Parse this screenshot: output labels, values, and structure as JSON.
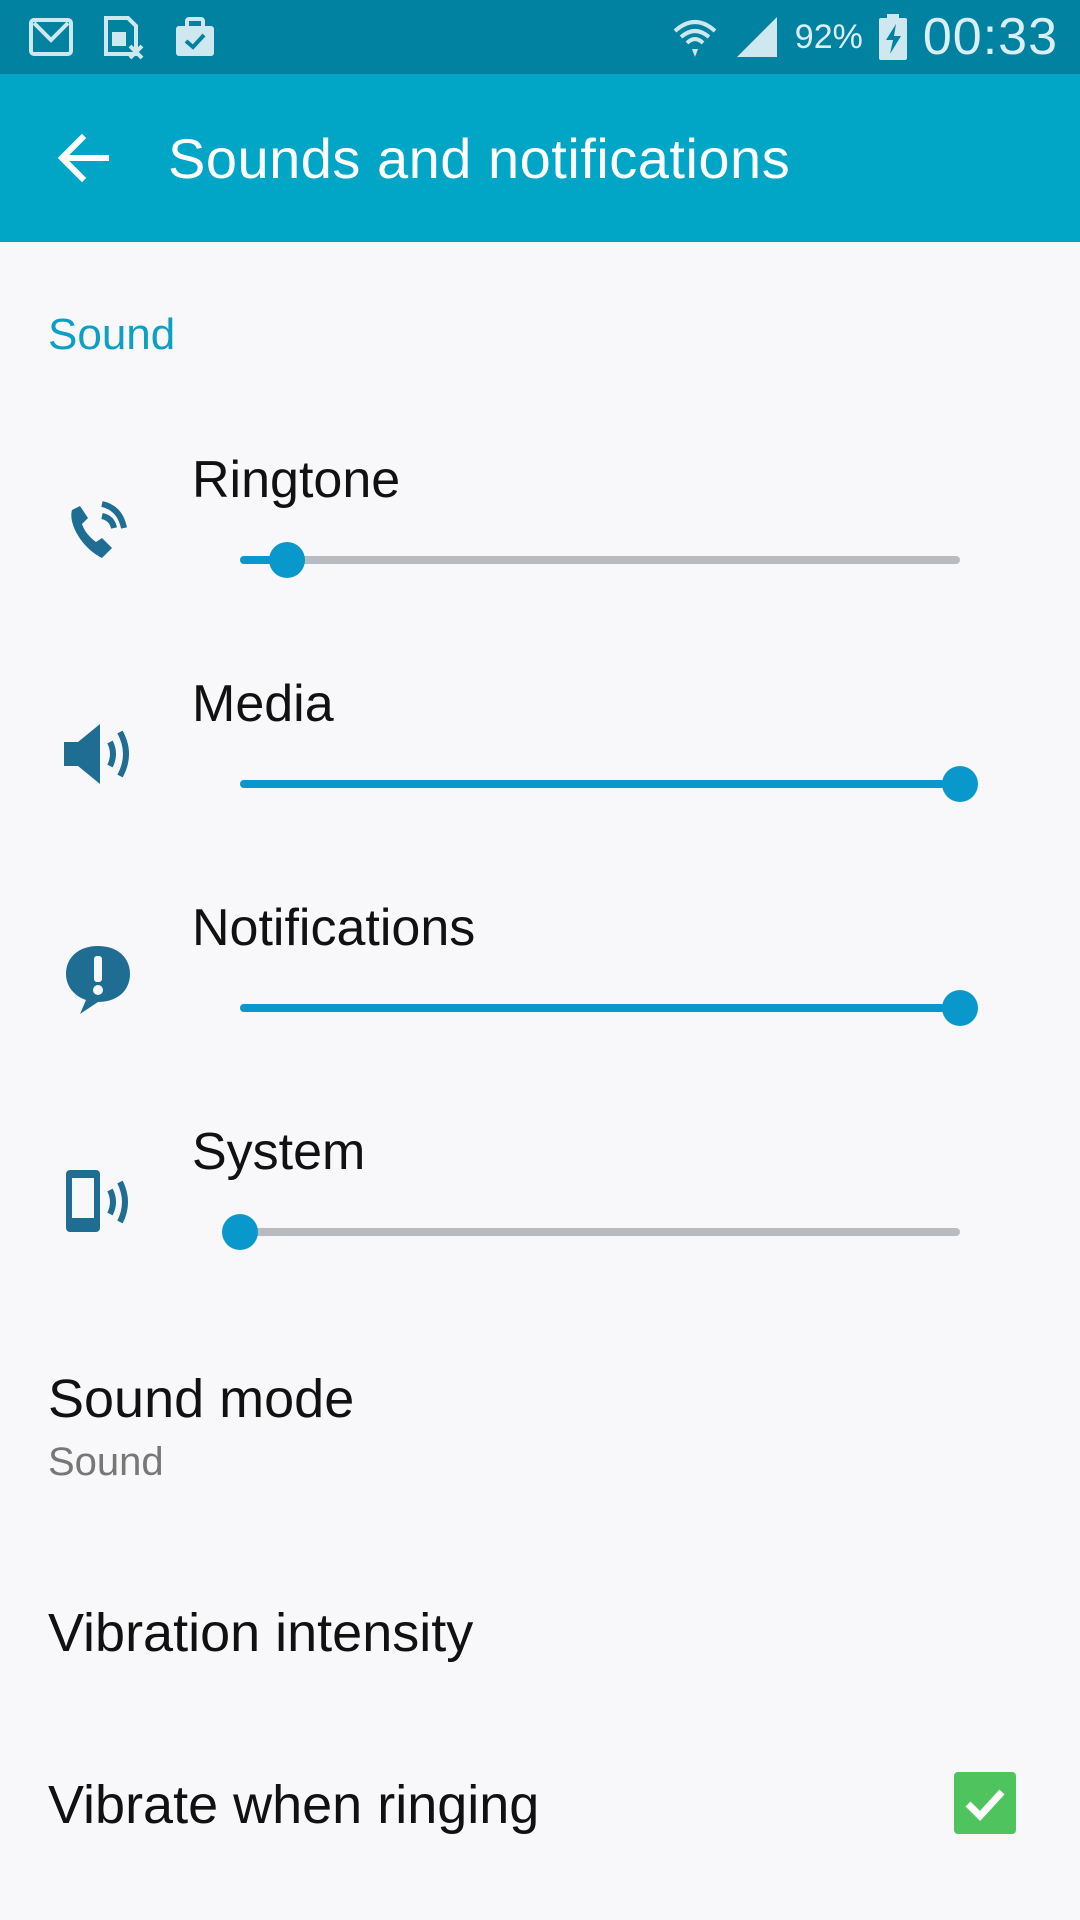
{
  "status_bar": {
    "left_icons": [
      "mail-icon",
      "sim-card-icon",
      "briefcase-icon"
    ],
    "right_icons": [
      "wifi-icon",
      "signal-icon",
      "battery-charging-icon"
    ],
    "battery_percent": "92%",
    "clock": "00:33"
  },
  "app_bar": {
    "title": "Sounds and notifications",
    "back_icon": "arrow-left-icon"
  },
  "section": {
    "header": "Sound"
  },
  "volumes": [
    {
      "label": "Ringtone",
      "icon": "phone-ring-icon",
      "level": 0.065
    },
    {
      "label": "Media",
      "icon": "speaker-icon",
      "level": 1.0
    },
    {
      "label": "Notifications",
      "icon": "notification-icon",
      "level": 1.0
    },
    {
      "label": "System",
      "icon": "phone-vibrate-icon",
      "level": 0.0
    }
  ],
  "sound_mode": {
    "title": "Sound mode",
    "value": "Sound"
  },
  "vibration_intensity": {
    "title": "Vibration intensity"
  },
  "vibrate_when_ringing": {
    "title": "Vibrate when ringing",
    "checked": true
  },
  "colors": {
    "status_bar": "#0282a1",
    "app_bar": "#01a5c6",
    "accent": "#0998cc",
    "checkbox": "#4fc35e"
  }
}
